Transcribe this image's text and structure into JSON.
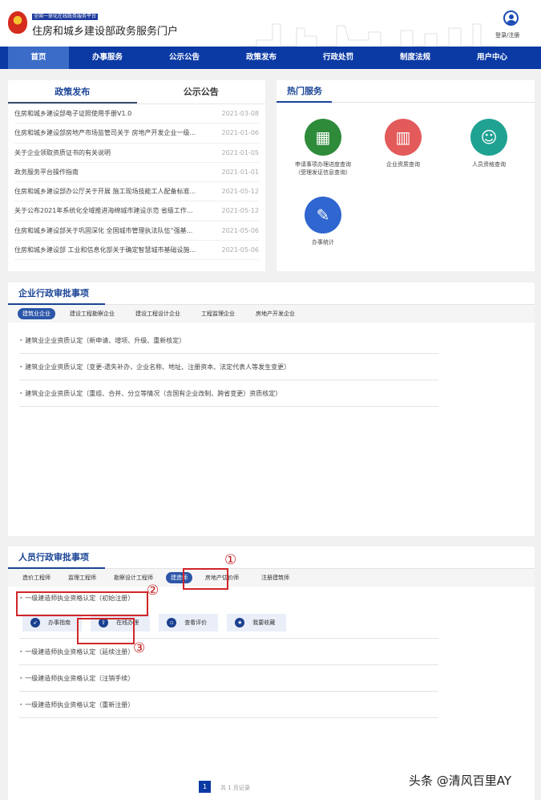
{
  "header": {
    "platform": "全国一体化在线政务服务平台",
    "title": "住房和城乡建设部政务服务门户",
    "login": "登录/注册"
  },
  "nav": [
    {
      "label": "首页"
    },
    {
      "label": "办事服务"
    },
    {
      "label": "公示公告"
    },
    {
      "label": "政策发布"
    },
    {
      "label": "行政处罚"
    },
    {
      "label": "制度法规"
    },
    {
      "label": "用户中心"
    }
  ],
  "news": {
    "tabs": [
      "政策发布",
      "公示公告"
    ],
    "items": [
      {
        "title": "住房和城乡建设部电子证照使用手册V1.0",
        "date": "2021-03-08"
      },
      {
        "title": "住房和城乡建设部房地产市场监管司关于 房地产开发企业一级...",
        "date": "2021-01-06"
      },
      {
        "title": "关于企业领取资质证书的有关说明",
        "date": "2021-01-05"
      },
      {
        "title": "政务服务平台操作指南",
        "date": "2021-01-01"
      },
      {
        "title": "住房和城乡建设部办公厅关于开展 施工现场技能工人配备标准...",
        "date": "2021-05-12"
      },
      {
        "title": "关于公布2021年系统化全域推进海绵城市建设示范 省级工作...",
        "date": "2021-05-12"
      },
      {
        "title": "住房和城乡建设部关于巩固深化 全国城市管理执法队伍“强基...",
        "date": "2021-05-06"
      },
      {
        "title": "住房和城乡建设部 工业和信息化部关于确定智慧城市基础设施...",
        "date": "2021-05-06"
      }
    ]
  },
  "hot": {
    "title": "热门服务",
    "items": [
      {
        "label1": "申请事项办理进度查询",
        "label2": "（受理发证信息查询）",
        "color": "#2e8b3a",
        "icon": "calculator-icon"
      },
      {
        "label1": "企业资质查询",
        "label2": "",
        "color": "#e35a5a",
        "icon": "building-icon"
      },
      {
        "label1": "人员资格查询",
        "label2": "",
        "color": "#20a293",
        "icon": "worker-icon"
      },
      {
        "label1": "办事统计",
        "label2": "",
        "color": "#2f66cf",
        "icon": "ruler-pencil-icon"
      }
    ]
  },
  "enterprise": {
    "title": "企业行政审批事项",
    "tabs": [
      "建筑业企业",
      "建设工程勘察企业",
      "建设工程设计企业",
      "工程监理企业",
      "房地产开发企业"
    ],
    "items": [
      "建筑业企业资质认定（新申请、增项、升级、重新核定）",
      "建筑业企业资质认定（变更-遗失补办，企业名称、地址、注册资本、法定代表人等发生变更）",
      "建筑业企业资质认定（重组、合并、分立等情况（含国有企业改制、跨省变更）资质核定）"
    ]
  },
  "personnel": {
    "title": "人员行政审批事项",
    "tabs": [
      "造价工程师",
      "监理工程师",
      "勘察设计工程师",
      "建造师",
      "房地产估价师",
      "注册建筑师"
    ],
    "items": [
      "一级建造师执业资格认定（初始注册）",
      "一级建造师执业资格认定（延续注册）",
      "一级建造师执业资格认定（注销手续）",
      "一级建造师执业资格认定（重新注册）"
    ],
    "actions": [
      "办事指南",
      "在线办理",
      "查看评价",
      "我要收藏"
    ]
  },
  "annotations": [
    "①",
    "②",
    "③"
  ],
  "pagination": {
    "page": "1",
    "total": "共 1 页记录"
  },
  "watermark": "头条 @清风百里AY"
}
